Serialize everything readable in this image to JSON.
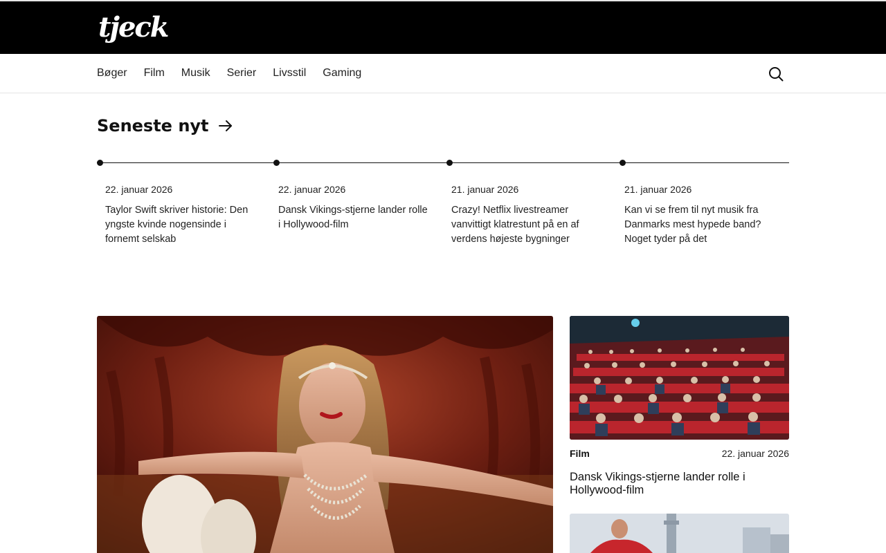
{
  "brand": {
    "logo_text": "tjeck"
  },
  "nav": {
    "items": [
      {
        "label": "Bøger"
      },
      {
        "label": "Film"
      },
      {
        "label": "Musik"
      },
      {
        "label": "Serier"
      },
      {
        "label": "Livsstil"
      },
      {
        "label": "Gaming"
      }
    ],
    "search_icon": "search-icon"
  },
  "latest": {
    "title": "Seneste nyt",
    "arrow_icon": "arrow-right-icon",
    "items": [
      {
        "date": "22. januar 2026",
        "title": "Taylor Swift skriver historie: Den yngste kvinde nogensinde i fornemt selskab"
      },
      {
        "date": "22. januar 2026",
        "title": "Dansk Vikings-stjerne lander rolle i Hollywood-film"
      },
      {
        "date": "21. januar 2026",
        "title": "Crazy! Netflix livestreamer vanvittigt klatrestunt på en af verdens højeste bygninger"
      },
      {
        "date": "21. januar 2026",
        "title": "Kan vi se frem til nyt musik fra Danmarks mest hypede band? Noget tyder på det"
      }
    ]
  },
  "featured_card": {
    "category": "Film",
    "date": "22. januar 2026",
    "title": "Dansk Vikings-stjerne lander rolle i Hollywood-film"
  },
  "colors": {
    "header_bg": "#000000",
    "text": "#111111",
    "accent_line": "#111111"
  }
}
